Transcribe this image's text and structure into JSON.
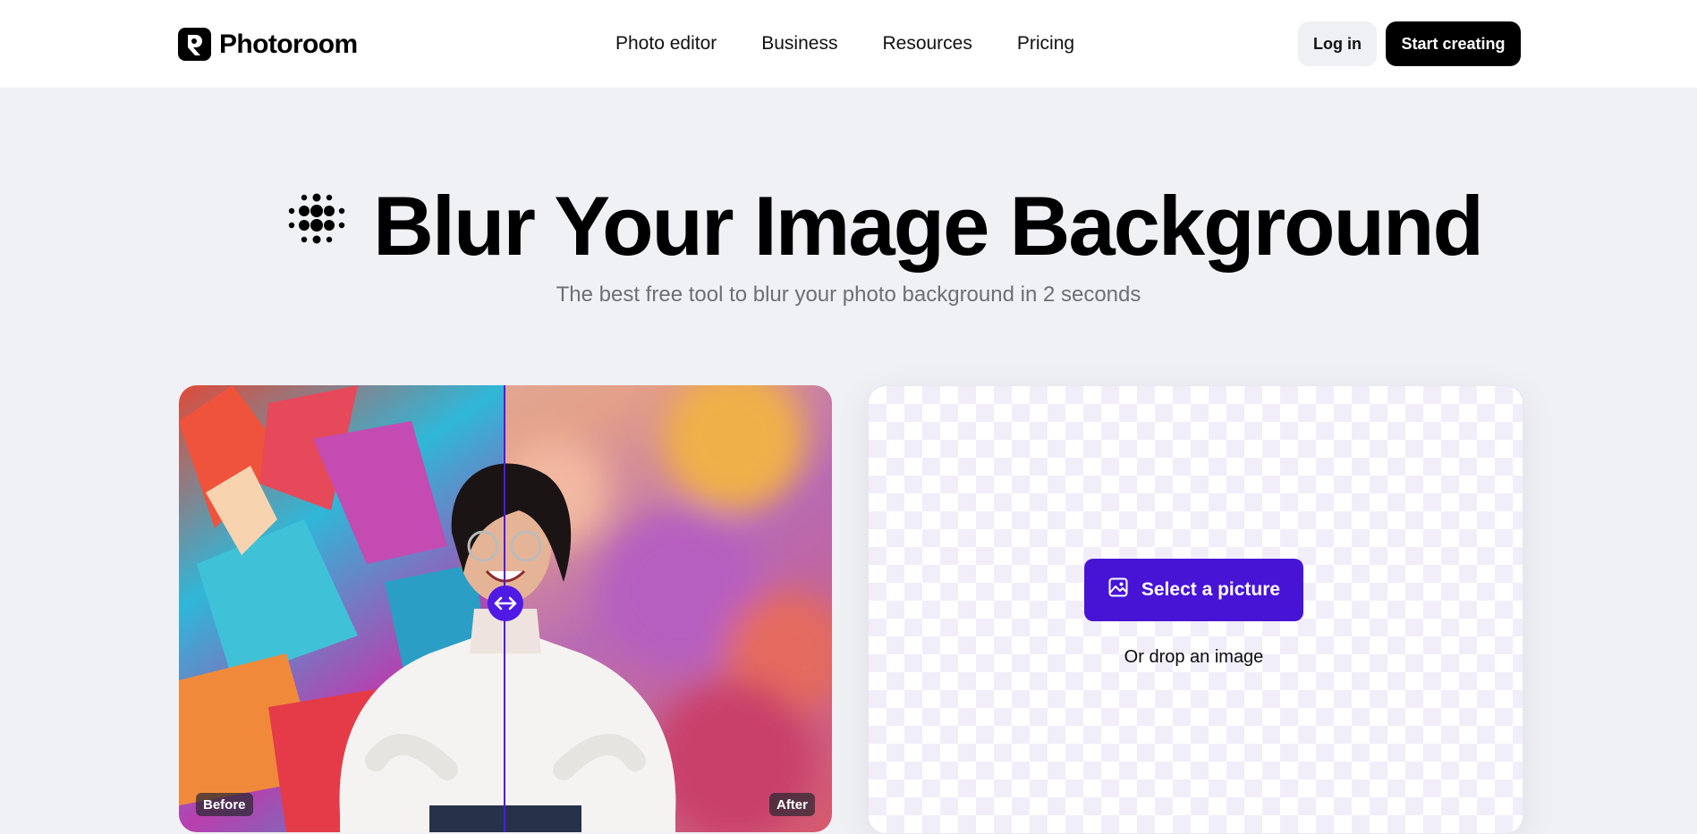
{
  "brand": {
    "name": "Photoroom",
    "icon": "photoroom-logo-icon"
  },
  "nav": {
    "items": [
      {
        "label": "Photo editor"
      },
      {
        "label": "Business"
      },
      {
        "label": "Resources"
      },
      {
        "label": "Pricing"
      }
    ],
    "login_label": "Log in",
    "cta_label": "Start creating"
  },
  "hero": {
    "icon": "blur-dots-icon",
    "title": "Blur Your Image Background",
    "subtitle": "The best free tool to blur your photo background in 2 seconds"
  },
  "compare": {
    "before_label": "Before",
    "after_label": "After",
    "handle_icon": "left-right-arrow-icon"
  },
  "upload": {
    "button_label": "Select a picture",
    "button_icon": "image-icon",
    "hint": "Or drop an image"
  },
  "colors": {
    "accent": "#4714d6",
    "page_bg": "#f0f1f5",
    "primary_button": "#000000"
  }
}
